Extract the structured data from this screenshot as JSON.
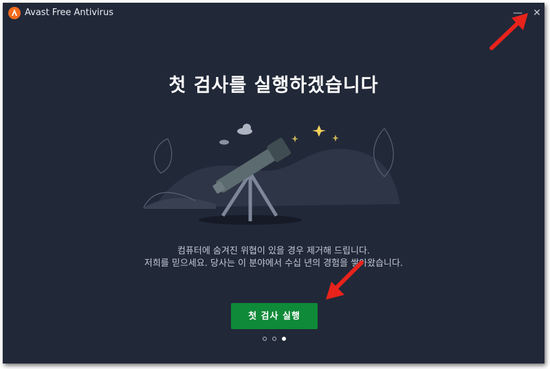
{
  "window": {
    "title": "Avast Free Antivirus",
    "minimize_glyph": "—",
    "close_glyph": "✕"
  },
  "main": {
    "heading": "첫 검사를 실행하겠습니다",
    "description_line1": "컴퓨터에 숨겨진 위협이 있을 경우 제거해 드립니다.",
    "description_line2": "저희를 믿으세요. 당사는 이 분야에서 수십 년의 경험을 쌓아왔습니다.",
    "scan_button_label": "첫 검사 실행",
    "pagination": {
      "total": 3,
      "active_index": 2
    }
  },
  "colors": {
    "background": "#212838",
    "accent": "#0f8a38",
    "brand": "#f26b1d",
    "annotation_arrow": "#e8231b"
  },
  "icons": [
    "avast-logo-icon",
    "minimize-icon",
    "close-icon",
    "telescope-illustration",
    "cloud-icon",
    "star-icon",
    "annotation-arrow"
  ]
}
